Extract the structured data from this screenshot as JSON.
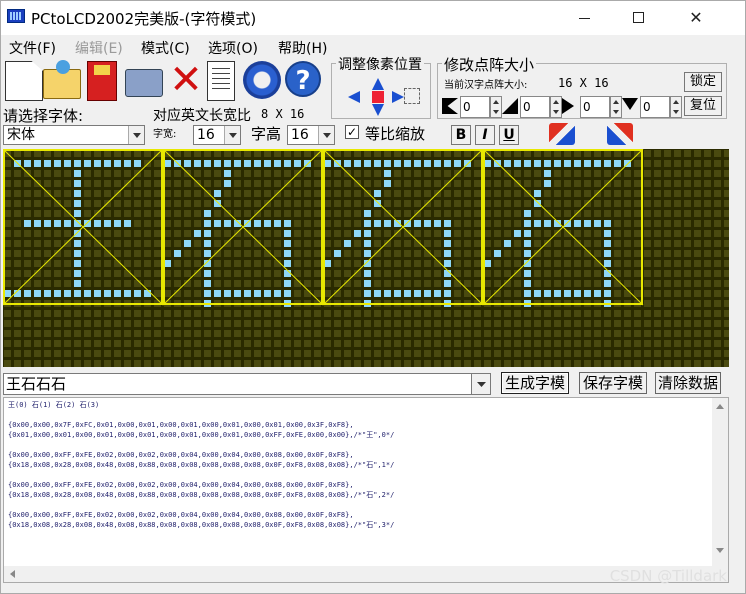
{
  "window": {
    "title": "PCtoLCD2002完美版-(字符模式)",
    "min": "",
    "max": "",
    "close": "✕"
  },
  "menu": [
    "文件(F)",
    "编辑(E)",
    "模式(C)",
    "选项(O)",
    "帮助(H)"
  ],
  "toolbar": {
    "delete_glyph": "✕",
    "help_glyph": "?",
    "pixel_group_title": "调整像素位置",
    "matrix_group_title": "修改点阵大小",
    "matrix_hint": "当前汉字点阵大小:",
    "matrix_size": "16 X 16",
    "lock_label": "锁定",
    "reset_label": "复位",
    "spin_values": [
      "0",
      "0",
      "0",
      "0"
    ],
    "font_label": "请选择字体:",
    "ratio_label": "对应英文长宽比",
    "ratio_value": "8 X 16",
    "font_value": "宋体",
    "width_label": "字宽:",
    "width_value": "16",
    "height_label": "字高",
    "height_value": "16",
    "checkbox_mark": "✓",
    "scale_label": "等比缩放",
    "bold_label": "B",
    "italic_label": "I",
    "underline_label": "U"
  },
  "lcd": {
    "pixel_color": "#8ed8f8",
    "off_color": "#2a2a00",
    "frame_color": "#e8e800",
    "characters": [
      "王",
      "石",
      "石",
      "石"
    ]
  },
  "input": {
    "text": "王石石石",
    "generate_label": "生成字模",
    "save_label": "保存字模",
    "clear_label": "清除数据"
  },
  "output": {
    "lines": [
      "王(0) 石(1) 石(2) 石(3)",
      "",
      "{0x00,0x00,0x7F,0xFC,0x01,0x00,0x01,0x00,0x01,0x00,0x01,0x00,0x01,0x00,0x3F,0xF8},",
      "{0x01,0x00,0x01,0x00,0x01,0x00,0x01,0x00,0x01,0x00,0x01,0x00,0xFF,0xFE,0x00,0x00},/*\"王\",0*/",
      "",
      "{0x00,0x00,0xFF,0xFE,0x02,0x00,0x02,0x00,0x04,0x00,0x04,0x00,0x08,0x00,0x0F,0xF8},",
      "{0x18,0x08,0x28,0x08,0x48,0x08,0x88,0x08,0x08,0x08,0x08,0x08,0x0F,0xF8,0x08,0x08},/*\"石\",1*/",
      "",
      "{0x00,0x00,0xFF,0xFE,0x02,0x00,0x02,0x00,0x04,0x00,0x04,0x00,0x08,0x00,0x0F,0xF8},",
      "{0x18,0x08,0x28,0x08,0x48,0x08,0x88,0x08,0x08,0x08,0x08,0x08,0x0F,0xF8,0x08,0x08},/*\"石\",2*/",
      "",
      "{0x00,0x00,0xFF,0xFE,0x02,0x00,0x02,0x00,0x04,0x00,0x04,0x00,0x08,0x00,0x0F,0xF8},",
      "{0x18,0x08,0x28,0x08,0x48,0x08,0x88,0x08,0x08,0x08,0x08,0x08,0x0F,0xF8,0x08,0x08},/*\"石\",3*/"
    ],
    "watermark": "CSDN @Tilldark"
  }
}
